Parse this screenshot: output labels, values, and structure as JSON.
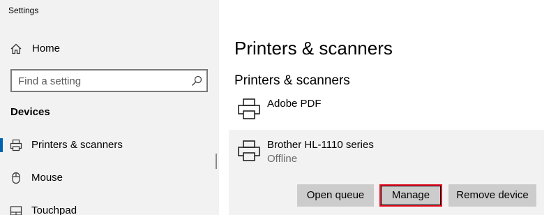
{
  "window": {
    "title": "Settings"
  },
  "sidebar": {
    "home_label": "Home",
    "search": {
      "placeholder": "Find a setting"
    },
    "section_heading": "Devices",
    "items": [
      {
        "label": "Printers & scanners",
        "icon": "printer-icon",
        "selected": true
      },
      {
        "label": "Mouse",
        "icon": "mouse-icon",
        "selected": false
      },
      {
        "label": "Touchpad",
        "icon": "touchpad-icon",
        "selected": false
      }
    ]
  },
  "main": {
    "page_title": "Printers & scanners",
    "subheading": "Printers & scanners",
    "devices": [
      {
        "name": "Adobe PDF",
        "status": "",
        "icon": "printer-icon"
      },
      {
        "name": "Brother HL-1110 series",
        "status": "Offline",
        "icon": "printer-icon",
        "expanded": true
      }
    ],
    "buttons": {
      "open_queue": "Open queue",
      "manage": "Manage",
      "remove_device": "Remove device"
    }
  },
  "colors": {
    "accent": "#0063b1",
    "highlight": "#e81123",
    "sidebar_bg": "#f2f2f2",
    "button_bg": "#cccccc"
  }
}
